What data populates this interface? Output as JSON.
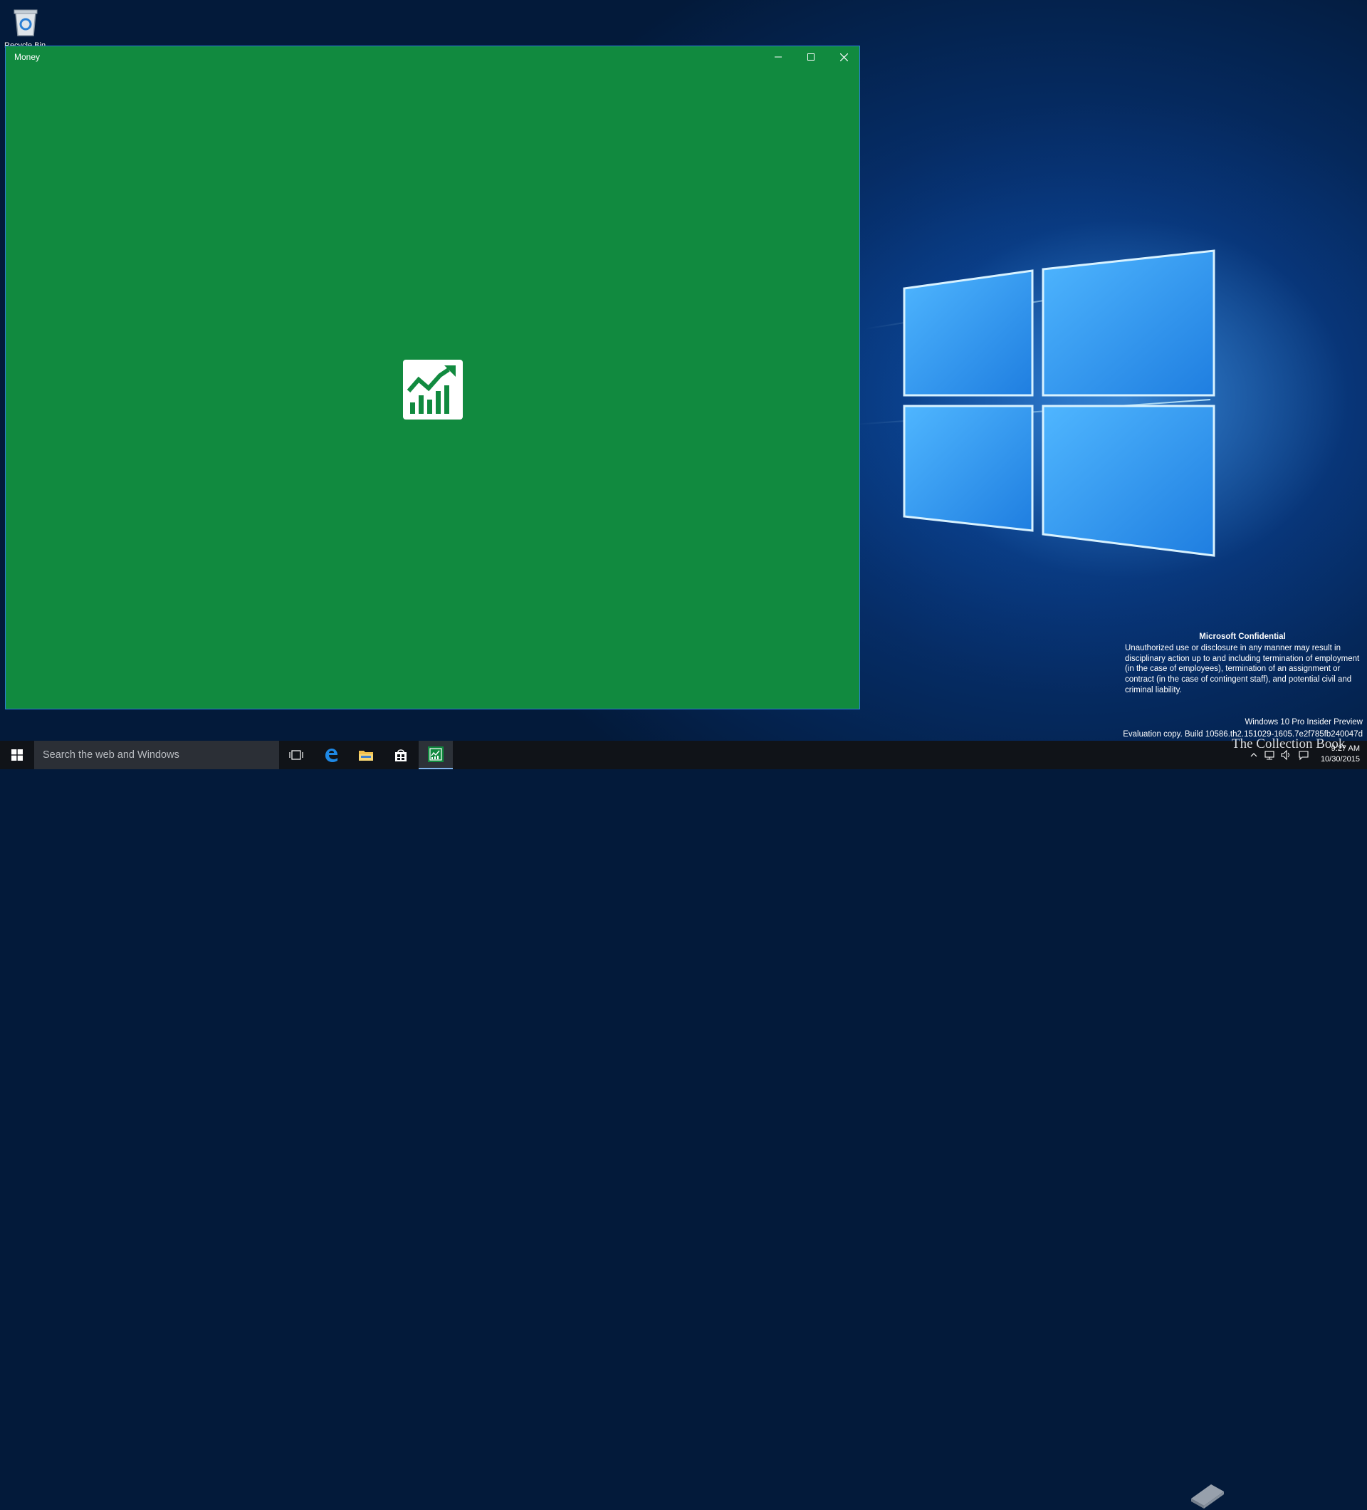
{
  "desktop": {
    "recycle_bin_label": "Recycle Bin",
    "notice": {
      "title": "Microsoft Confidential",
      "body": "Unauthorized use or disclosure in any manner may result in disciplinary action up to and including termination of employment (in the case of employees), termination of an assignment or contract (in the case of contingent staff), and potential civil and criminal liability."
    },
    "edition": "Windows 10 Pro Insider Preview",
    "build": "Evaluation copy. Build 10586.th2.151029-1605.7e2f785fb240047d",
    "watermark": "The Collection Book"
  },
  "window": {
    "title": "Money",
    "accent": "#118a3f",
    "splash_icon": "money-chart-icon",
    "buttons": {
      "minimize": "minimize-icon",
      "maximize": "maximize-icon",
      "close": "close-icon"
    }
  },
  "taskbar": {
    "search_placeholder": "Search the web and Windows",
    "apps": [
      "task-view-icon",
      "edge-icon",
      "file-explorer-icon",
      "store-icon",
      "money-app-icon"
    ],
    "clock": {
      "time": "9:27 AM",
      "date": "10/30/2015"
    }
  }
}
